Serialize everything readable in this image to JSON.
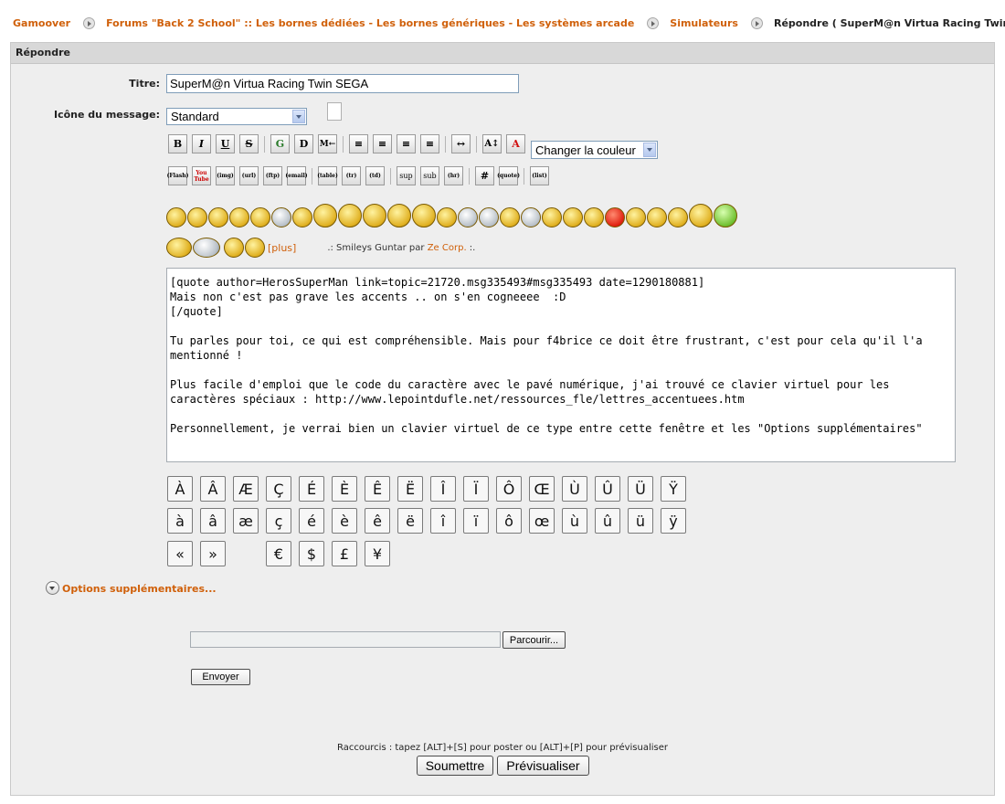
{
  "breadcrumb": [
    {
      "label": "Gamoover",
      "link": true
    },
    {
      "label": "Forums \"Back 2 School\" :: Les bornes dédiées - Les bornes génériques - Les systèmes arcade",
      "link": true
    },
    {
      "label": "Simulateurs",
      "link": true
    },
    {
      "label": "Répondre ( SuperM@n Virtua Racing Twin SEGA )",
      "link": false
    }
  ],
  "panel_title": "Répondre",
  "form": {
    "title_label": "Titre:",
    "title_value": "SuperM@n Virtua Racing Twin SEGA",
    "icon_label": "Icône du message:",
    "icon_value": "Standard",
    "color_select": "Changer la couleur"
  },
  "toolbar1": [
    "B",
    "I",
    "U",
    "S",
    "G",
    "D",
    "M←",
    "≡",
    "≡",
    "≡",
    "≡",
    "↔",
    "A↕",
    "A"
  ],
  "toolbar2": [
    "(Flash)",
    "You Tube",
    "(img)",
    "(url)",
    "(ftp)",
    "(email)",
    "(table)",
    "(tr)",
    "(td)",
    "sup",
    "sub",
    "(hr)",
    "#",
    "(quote)",
    "(list)"
  ],
  "smileys": {
    "more_link": "[plus]",
    "credit_prefix": ".: Smileys Guntar par ",
    "credit_link": "Ze Corp.",
    "credit_suffix": " :."
  },
  "message_text": "[quote author=HerosSuperMan link=topic=21720.msg335493#msg335493 date=1290180881]\nMais non c'est pas grave les accents .. on s'en cogneeee  :D\n[/quote]\n\nTu parles pour toi, ce qui est compréhensible. Mais pour f4brice ce doit être frustrant, c'est pour cela qu'il l'a mentionné !\n\nPlus facile d'emploi que le code du caractère avec le pavé numérique, j'ai trouvé ce clavier virtuel pour les caractères spéciaux : http://www.lepointdufle.net/ressources_fle/lettres_accentuees.htm\n\nPersonnellement, je verrai bien un clavier virtuel de ce type entre cette fenêtre et les \"Options supplémentaires\"",
  "keyboard": {
    "row1": [
      "À",
      "Â",
      "Æ",
      "Ç",
      "É",
      "È",
      "Ê",
      "Ë",
      "Î",
      "Ï",
      "Ô",
      "Œ",
      "Ù",
      "Û",
      "Ü",
      "Ÿ"
    ],
    "row2": [
      "à",
      "â",
      "æ",
      "ç",
      "é",
      "è",
      "ê",
      "ë",
      "î",
      "ï",
      "ô",
      "œ",
      "ù",
      "û",
      "ü",
      "ÿ"
    ],
    "row3a": [
      "«",
      "»"
    ],
    "row3b": [
      "€",
      "$",
      "£",
      "¥"
    ]
  },
  "options_label": "Options supplémentaires...",
  "browse_button": "Parcourir...",
  "send_button": "Envoyer",
  "shortcuts_text": "Raccourcis : tapez [ALT]+[S] pour poster ou [ALT]+[P] pour prévisualiser",
  "submit_button": "Soumettre",
  "preview_button": "Prévisualiser"
}
